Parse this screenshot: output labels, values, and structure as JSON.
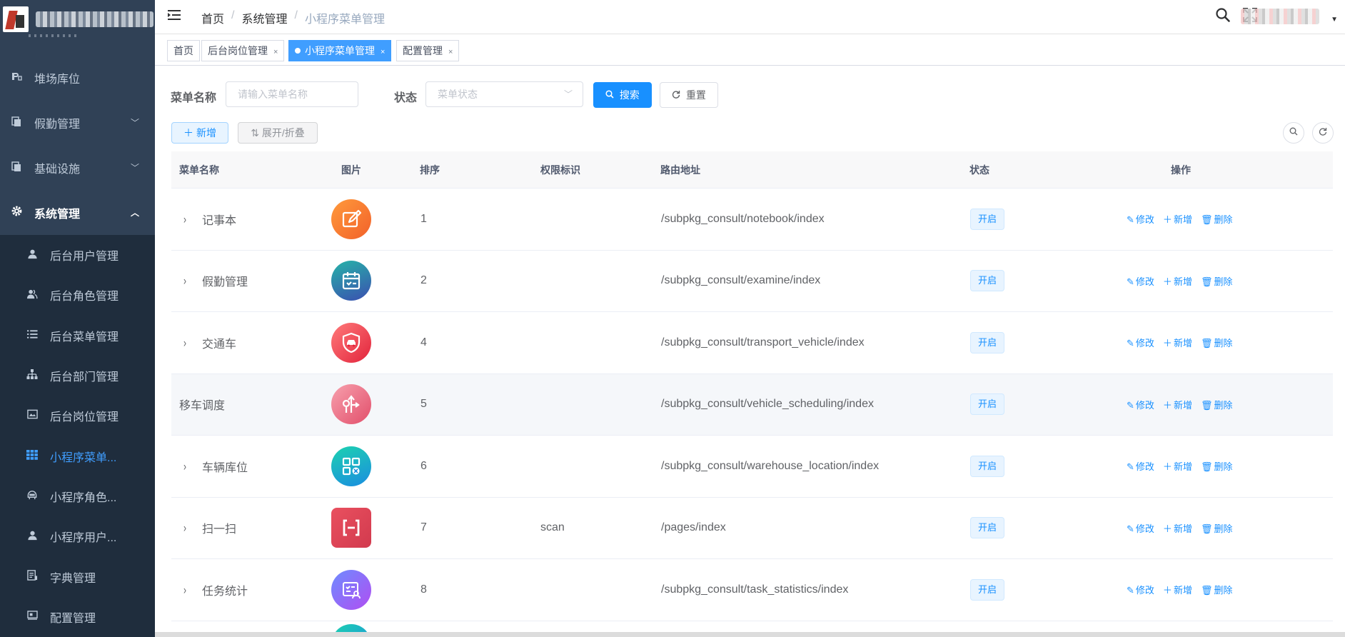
{
  "sidebar": {
    "top_items": [
      {
        "label": "堆场库位",
        "icon": "parking-icon"
      },
      {
        "label": "假勤管理",
        "icon": "documents-icon",
        "arrow": "﹀"
      },
      {
        "label": "基础设施",
        "icon": "documents-icon",
        "arrow": "﹀"
      },
      {
        "label": "系统管理",
        "icon": "gear-icon",
        "arrow": "︿"
      }
    ],
    "sub_items": [
      {
        "label": "后台用户管理",
        "icon": "user-icon"
      },
      {
        "label": "后台角色管理",
        "icon": "user-group-icon"
      },
      {
        "label": "后台菜单管理",
        "icon": "list-icon"
      },
      {
        "label": "后台部门管理",
        "icon": "tree-icon"
      },
      {
        "label": "后台岗位管理",
        "icon": "post-icon"
      },
      {
        "label": "小程序菜单...",
        "icon": "grid-icon"
      },
      {
        "label": "小程序角色...",
        "icon": "role-icon"
      },
      {
        "label": "小程序用户...",
        "icon": "user-icon"
      },
      {
        "label": "字典管理",
        "icon": "dict-icon"
      },
      {
        "label": "配置管理",
        "icon": "config-icon"
      }
    ]
  },
  "header": {
    "breadcrumb": [
      "首页",
      "系统管理",
      "小程序菜单管理"
    ],
    "separator": "/"
  },
  "tags": [
    {
      "label": "首页"
    },
    {
      "label": "后台岗位管理",
      "close": "×"
    },
    {
      "label": "小程序菜单管理",
      "close": "×"
    },
    {
      "label": "配置管理",
      "close": "×"
    }
  ],
  "search": {
    "menu_name_label": "菜单名称",
    "menu_name_placeholder": "请输入菜单名称",
    "status_label": "状态",
    "status_placeholder": "菜单状态",
    "search_button": "搜索",
    "reset_button": "重置"
  },
  "toolbar": {
    "add_button": "新增",
    "expand_button": "展开/折叠"
  },
  "table": {
    "columns": [
      "菜单名称",
      "图片",
      "排序",
      "权限标识",
      "路由地址",
      "状态",
      "操作"
    ],
    "rows": [
      {
        "name": "记事本",
        "has_children": true,
        "icon": "notebook-icon",
        "color_from": "#ff9a3c",
        "color_to": "#f2612a",
        "order": "1",
        "perms": "",
        "path": "/subpkg_consult/notebook/index",
        "status": "开启"
      },
      {
        "name": "假勤管理",
        "has_children": true,
        "icon": "calendar-check-icon",
        "color_from": "#26b3a8",
        "color_to": "#3b4fb0",
        "order": "2",
        "perms": "",
        "path": "/subpkg_consult/examine/index",
        "status": "开启"
      },
      {
        "name": "交通车",
        "has_children": true,
        "icon": "car-shield-icon",
        "color_from": "#ff7a7a",
        "color_to": "#e2243c",
        "order": "4",
        "perms": "",
        "path": "/subpkg_consult/transport_vehicle/index",
        "status": "开启"
      },
      {
        "name": "移车调度",
        "has_children": false,
        "icon": "route-icon",
        "color_from": "#f7a0ad",
        "color_to": "#e24f6b",
        "order": "5",
        "perms": "",
        "path": "/subpkg_consult/vehicle_scheduling/index",
        "status": "开启"
      },
      {
        "name": "车辆库位",
        "has_children": true,
        "icon": "apps-icon",
        "color_from": "#1dd1b0",
        "color_to": "#1a8de0",
        "order": "6",
        "perms": "",
        "path": "/subpkg_consult/warehouse_location/index",
        "status": "开启"
      },
      {
        "name": "扫一扫",
        "has_children": true,
        "icon": "scan-icon",
        "color_from": "#e9505f",
        "color_to": "#d23a4e",
        "order": "7",
        "perms": "scan",
        "path": "/pages/index",
        "status": "开启"
      },
      {
        "name": "任务统计",
        "has_children": true,
        "icon": "task-icon",
        "color_from": "#6e8cff",
        "color_to": "#b04ef2",
        "order": "8",
        "perms": "",
        "path": "/subpkg_consult/task_statistics/index",
        "status": "开启"
      }
    ],
    "actions": {
      "edit": "修改",
      "add": "新增",
      "delete": "删除"
    }
  },
  "colors": {
    "sidebar_bg": "#304156",
    "submenu_bg": "#1f2d3d",
    "primary": "#1890ff",
    "active_menu": "#409eff"
  }
}
